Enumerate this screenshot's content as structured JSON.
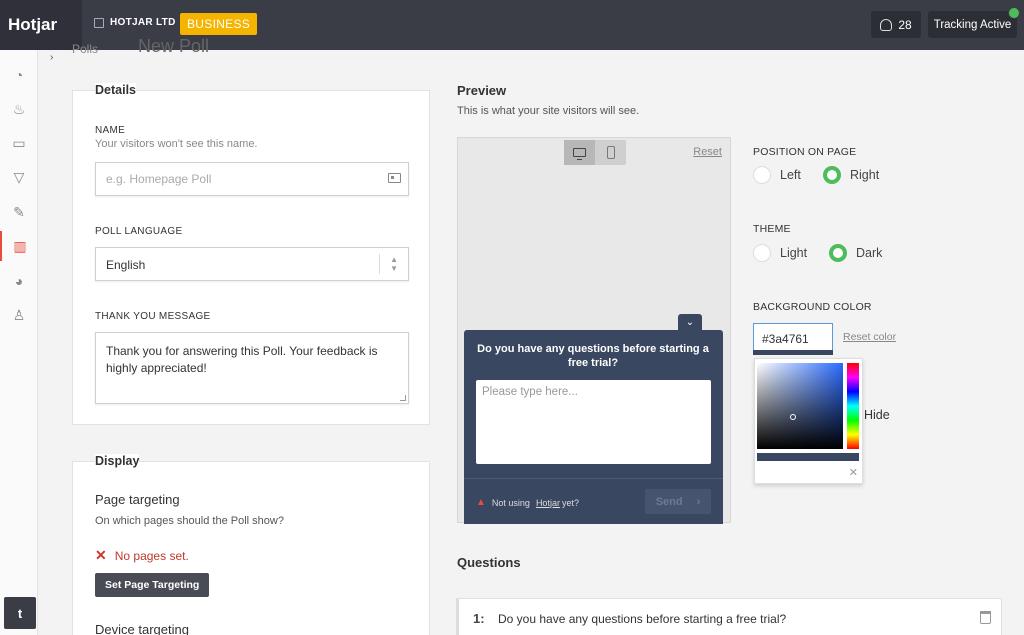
{
  "topbar": {
    "brand": "Hotjar",
    "org_name": "HOTJAR LTD",
    "plan_badge": "BUSINESS",
    "users_count": "28",
    "tracking_label": "Tracking Active"
  },
  "header": {
    "breadcrumb": "Polls",
    "page_title": "New Poll"
  },
  "sidebar": {
    "items": [
      {
        "name": "dashboard",
        "icon": "gauge-icon"
      },
      {
        "name": "heatmaps",
        "icon": "flame-icon"
      },
      {
        "name": "recordings",
        "icon": "camera-icon"
      },
      {
        "name": "funnels",
        "icon": "funnel-icon"
      },
      {
        "name": "forms",
        "icon": "pencil-icon"
      },
      {
        "name": "polls",
        "icon": "bar-chart-icon",
        "active": true
      },
      {
        "name": "surveys",
        "icon": "pie-chart-icon"
      },
      {
        "name": "recruiters",
        "icon": "user-icon"
      }
    ],
    "twitter_icon": "t"
  },
  "details": {
    "heading": "Details",
    "name_label": "NAME",
    "name_hint": "Your visitors won't see this name.",
    "name_placeholder": "e.g. Homepage Poll",
    "language_label": "POLL LANGUAGE",
    "language_value": "English",
    "thankyou_label": "THANK YOU MESSAGE",
    "thankyou_value": "Thank you for answering this Poll. Your feedback is highly appreciated!"
  },
  "display": {
    "heading": "Display",
    "page_targeting_title": "Page targeting",
    "page_targeting_hint": "On which pages should the Poll show?",
    "page_targeting_error": "No pages set.",
    "set_targeting_button": "Set Page Targeting",
    "device_targeting_title": "Device targeting"
  },
  "preview": {
    "title": "Preview",
    "subtitle": "This is what your site visitors will see.",
    "reset_label": "Reset",
    "poll_question": "Do you have any questions before starting a free trial?",
    "poll_placeholder": "Please type here...",
    "poll_note_prefix": "Not using",
    "poll_note_link": "Hotjar",
    "poll_note_suffix": "yet?",
    "send_label": "Send",
    "widget_color": "#3a4761"
  },
  "options": {
    "position_label": "POSITION ON PAGE",
    "position_left": "Left",
    "position_right": "Right",
    "position_selected": "Right",
    "theme_label": "THEME",
    "theme_light": "Light",
    "theme_dark": "Dark",
    "theme_selected": "Dark",
    "bg_label": "BACKGROUND COLOR",
    "bg_value": "#3a4761",
    "reset_color": "Reset color",
    "hide_label": "Hide"
  },
  "questions": {
    "title": "Questions",
    "items": [
      {
        "num": "1:",
        "text": "Do you have any questions before starting a free trial?"
      }
    ]
  },
  "colors": {
    "topbar": "#3a3c46",
    "badge": "#f4b400",
    "accent_green": "#4dbd5b",
    "error_red": "#c0392b"
  }
}
